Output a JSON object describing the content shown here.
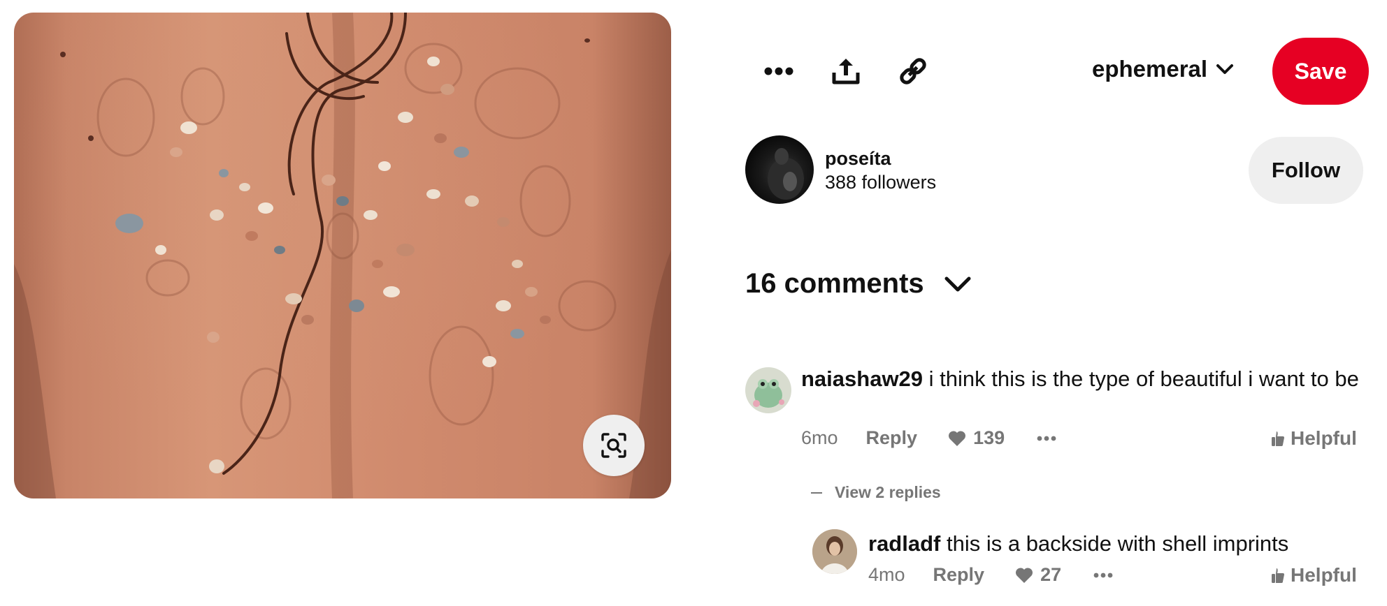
{
  "toolbar": {
    "more_icon": "more-icon",
    "share_icon": "share-icon",
    "link_icon": "link-icon",
    "board_name": "ephemeral",
    "save_label": "Save"
  },
  "creator": {
    "name": "poseíta",
    "followers": "388 followers",
    "follow_label": "Follow"
  },
  "comments_section": {
    "header": "16 comments"
  },
  "comments": [
    {
      "username": "naiashaw29",
      "text": "i think this is the type of beautiful i want to be",
      "time": "6mo",
      "reply_label": "Reply",
      "likes": "139",
      "helpful_label": "Helpful",
      "view_replies": "View 2 replies"
    },
    {
      "username": "radladf",
      "text": "this is a backside with shell imprints",
      "time": "4mo",
      "reply_label": "Reply",
      "likes": "27",
      "helpful_label": "Helpful"
    }
  ],
  "colors": {
    "save_button": "#e60023",
    "follow_button": "#efefef",
    "muted_text": "#767676"
  }
}
